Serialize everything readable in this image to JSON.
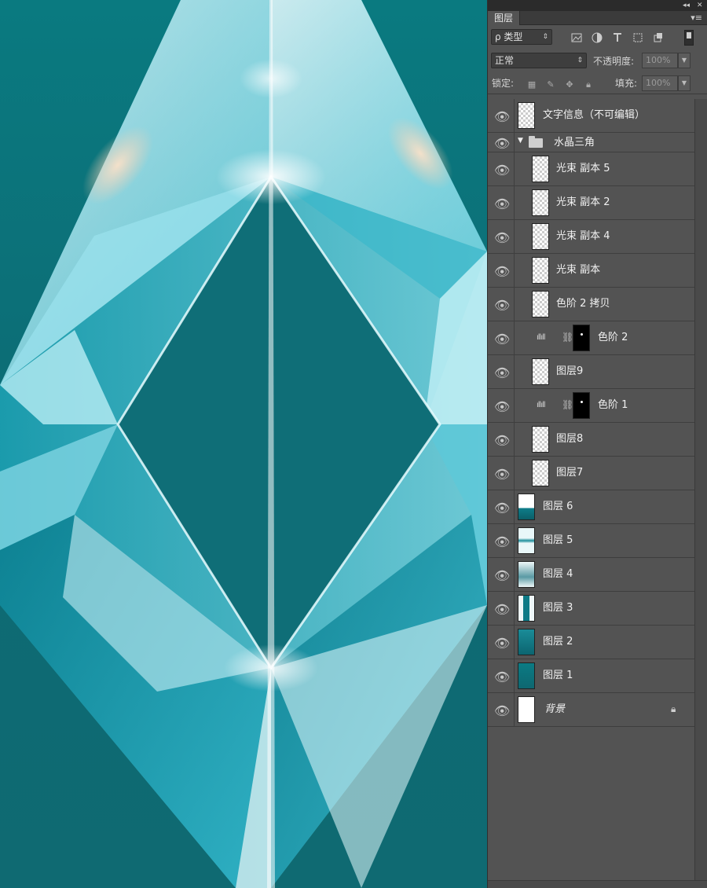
{
  "panel": {
    "tab_label": "图层",
    "collapse_glyph": "◂◂",
    "close_glyph": "✕",
    "menu_glyph": "▾≡"
  },
  "filter": {
    "kind_label": "ρ 类型",
    "arrow": "⇕"
  },
  "blend": {
    "mode": "正常",
    "opacity_label": "不透明度:",
    "opacity_value": "100%",
    "lock_label": "锁定:",
    "fill_label": "填充:",
    "fill_value": "100%"
  },
  "layers": [
    {
      "name": "文字信息（不可编辑）"
    },
    {
      "name": "水晶三角",
      "type": "group"
    },
    {
      "name": "光束 副本 5"
    },
    {
      "name": "光束 副本 2"
    },
    {
      "name": "光束 副本 4"
    },
    {
      "name": "光束 副本"
    },
    {
      "name": "色阶 2 拷贝"
    },
    {
      "name": "色阶 2",
      "type": "adjustment"
    },
    {
      "name": "图层9"
    },
    {
      "name": "色阶 1",
      "type": "adjustment"
    },
    {
      "name": "图层8"
    },
    {
      "name": "图层7"
    },
    {
      "name": "图层 6"
    },
    {
      "name": "图层 5"
    },
    {
      "name": "图层 4"
    },
    {
      "name": "图层 3"
    },
    {
      "name": "图层 2"
    },
    {
      "name": "图层 1"
    },
    {
      "name": "背景",
      "locked": true
    }
  ],
  "colors": {
    "canvas_bg": "#0d6a74",
    "crystal_light": "#e8fbff",
    "crystal_mid": "#4fc0d2",
    "panel_bg": "#535353"
  },
  "icons": {
    "eye": "eye-icon",
    "lock": "lock-icon",
    "chain": "chain-icon",
    "folder": "folder-icon",
    "levels": "levels-icon"
  }
}
